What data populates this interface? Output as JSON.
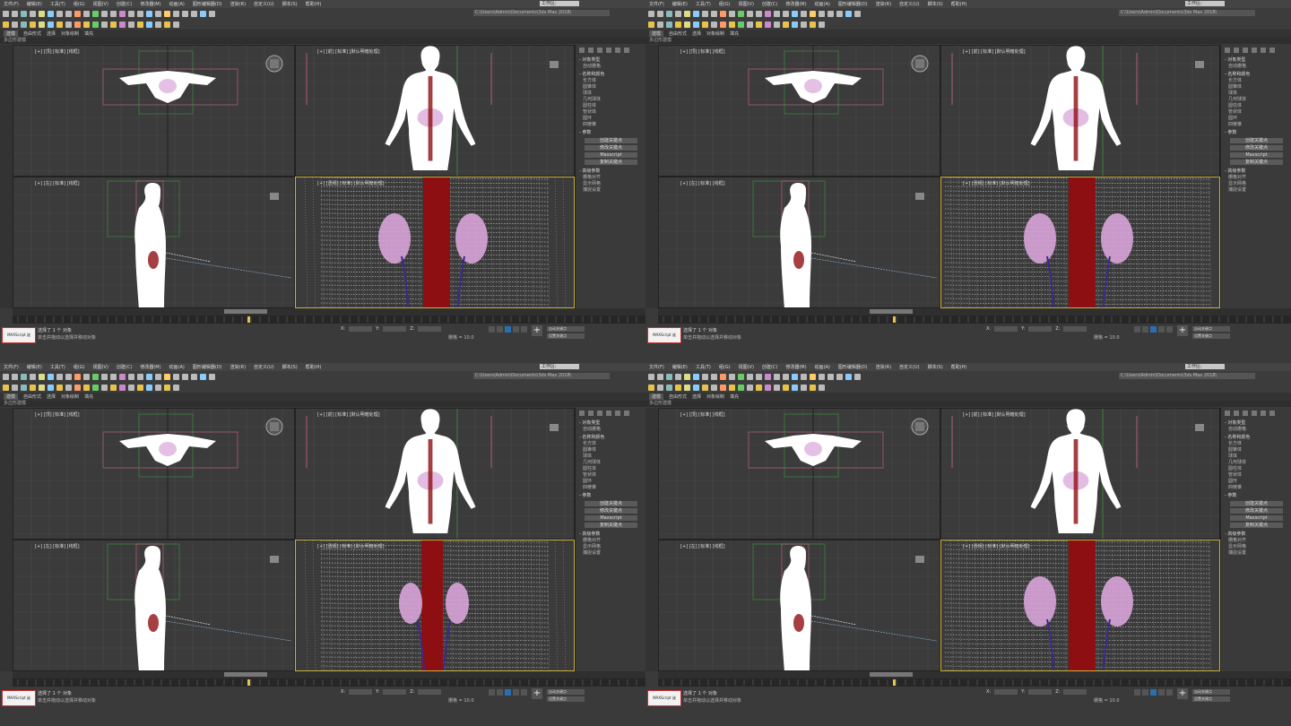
{
  "menu": [
    "文件(F)",
    "编辑(E)",
    "工具(T)",
    "组(G)",
    "视图(V)",
    "创建(C)",
    "修改器(M)",
    "动画(A)",
    "图形编辑器(D)",
    "渲染(R)",
    "自定义(U)",
    "脚本(S)",
    "帮助(H)"
  ],
  "workspace": "工作区:",
  "file_path": "C:\\Users\\Admin\\Documents\\3ds Max 2018\\",
  "ribbon_tabs": [
    "建模",
    "自由形式",
    "选择",
    "对象绘制",
    "填充"
  ],
  "sub_ribbon": "多边形建模",
  "viewports": {
    "top": "[+] [顶] [标准] [线框]",
    "front": "[+] [前] [标准] [默认明暗处理]",
    "left": "[+] [左] [标准] [线框]",
    "persp": "[+] [透视] [标准] [默认明暗处理]"
  },
  "command_panel": {
    "rollout_object_type": "- 对象类型",
    "auto_grid": "自动栅格",
    "rollout_name_color": "- 名称和颜色",
    "rows": [
      "长方体",
      "圆锥体",
      "球体",
      "几何球体",
      "圆柱体",
      "管状体",
      "圆环",
      "四棱锥"
    ],
    "rollout_params": "- 参数",
    "buttons": [
      "创建关键点",
      "修改关键点",
      "Maxscript",
      "复制关键点"
    ],
    "rollout_bottom": "- 高级参数",
    "bottom_rows": [
      "栅格对齐",
      "显示网格",
      "捕捉设置"
    ]
  },
  "status": {
    "script_box": "MAXScript 迷",
    "selection": "选择了 1 个 对象",
    "hint": "单击并拖动以选择并移动对象",
    "x": "X:",
    "y": "Y:",
    "z": "Z:",
    "grid": "栅格 = 10.0",
    "add_key": "+",
    "auto_key": "自动关键点",
    "set_key": "设置关键点"
  },
  "colors": {
    "bg": "#2b2b2b",
    "viewport": "#3b3b3b",
    "active_border": "#c8b03a",
    "kidney": "#d9a5d9",
    "aorta": "#8e0f12",
    "wire": "#ffffff",
    "vein": "#3a2a8a"
  }
}
